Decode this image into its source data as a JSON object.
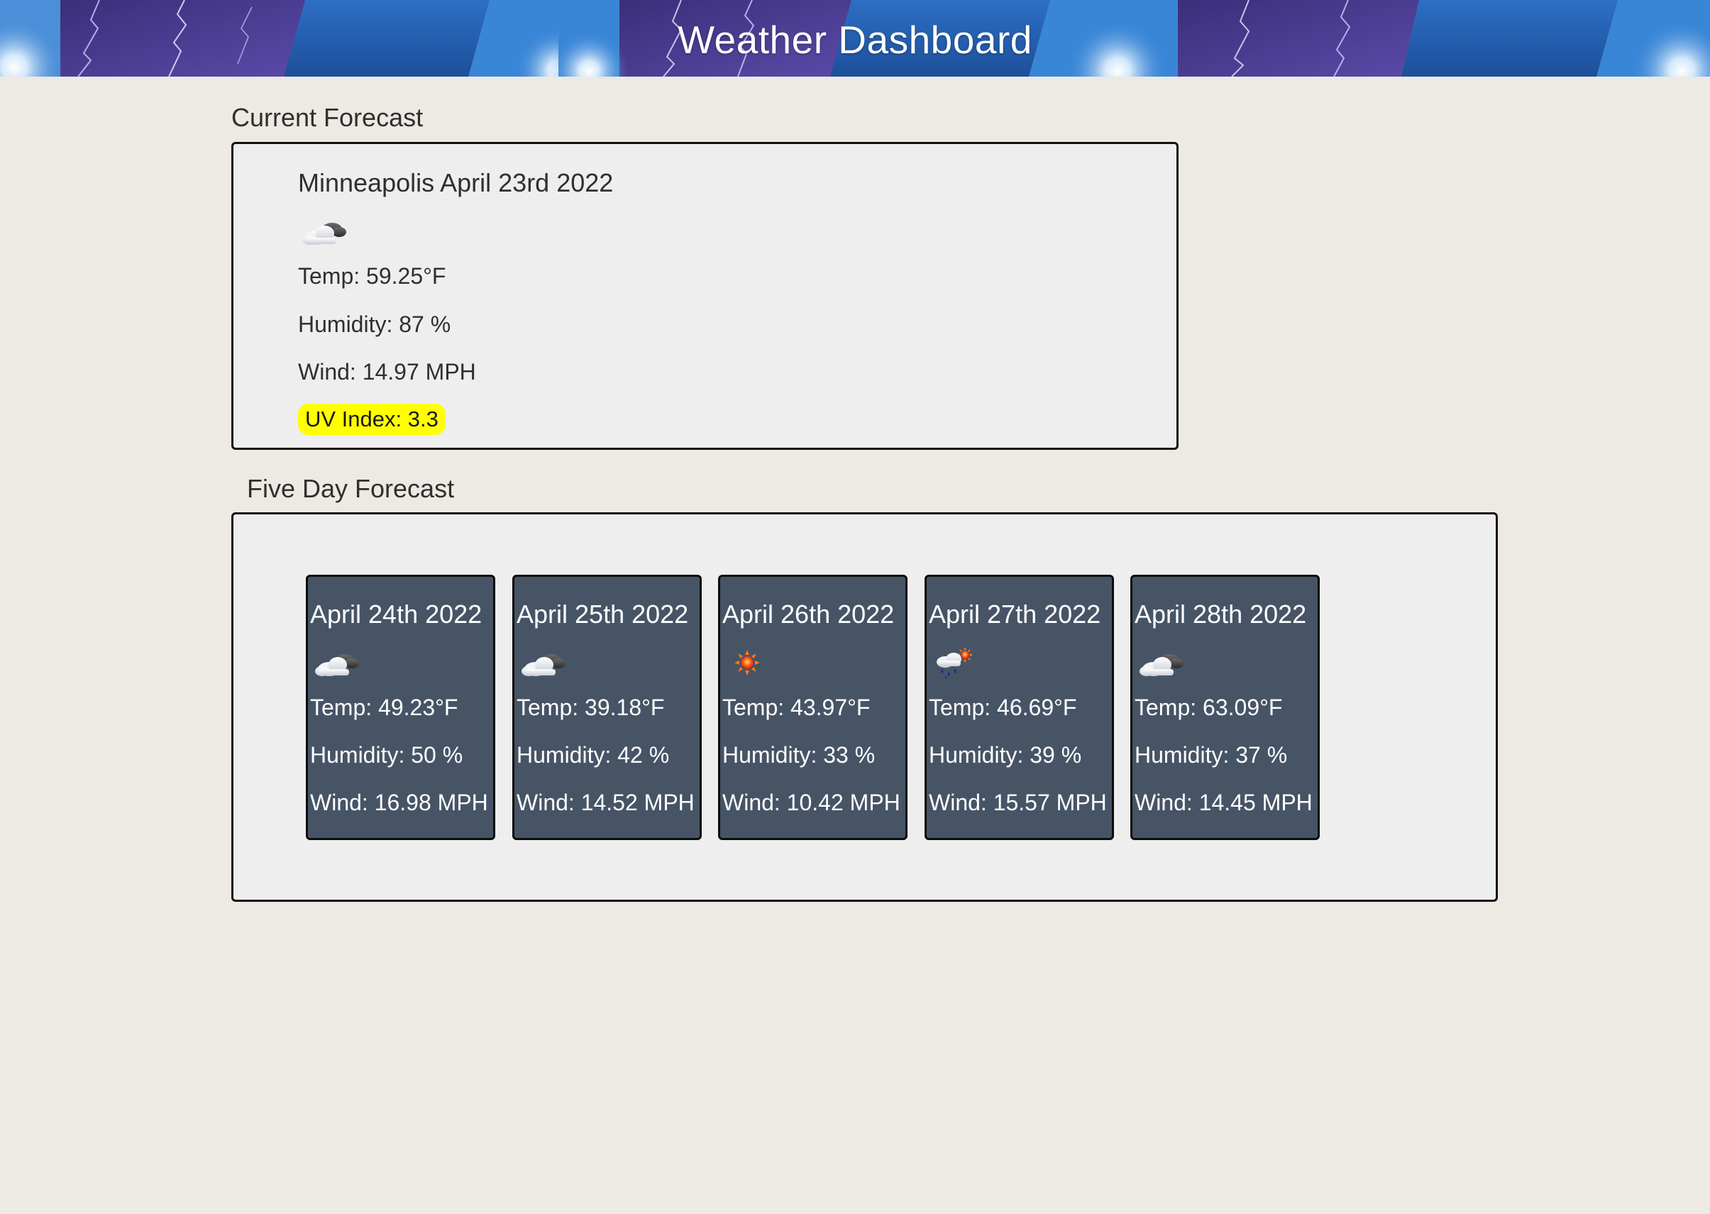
{
  "header": {
    "title": "Weather Dashboard"
  },
  "current": {
    "heading": "Current Forecast",
    "city_date": "Minneapolis April 23rd 2022",
    "icon": "partly-cloudy-icon",
    "temp": "Temp: 59.25°F",
    "humidity": "Humidity: 87 %",
    "wind": "Wind: 14.97 MPH",
    "uv": "UV Index: 3.3",
    "uv_color": "#ffff00"
  },
  "five_day": {
    "heading": "Five Day Forecast",
    "card_color": "#465466",
    "days": [
      {
        "date": "April 24th 2022",
        "icon": "partly-cloudy-icon",
        "temp": "Temp: 49.23°F",
        "humidity": "Humidity: 50 %",
        "wind": "Wind: 16.98 MPH"
      },
      {
        "date": "April 25th 2022",
        "icon": "partly-cloudy-icon",
        "temp": "Temp: 39.18°F",
        "humidity": "Humidity: 42 %",
        "wind": "Wind: 14.52 MPH"
      },
      {
        "date": "April 26th 2022",
        "icon": "sun-icon",
        "temp": "Temp: 43.97°F",
        "humidity": "Humidity: 33 %",
        "wind": "Wind: 10.42 MPH"
      },
      {
        "date": "April 27th 2022",
        "icon": "rain-sun-icon",
        "temp": "Temp: 46.69°F",
        "humidity": "Humidity: 39 %",
        "wind": "Wind: 15.57 MPH"
      },
      {
        "date": "April 28th 2022",
        "icon": "partly-cloudy-icon",
        "temp": "Temp: 63.09°F",
        "humidity": "Humidity: 37 %",
        "wind": "Wind: 14.45 MPH"
      }
    ]
  }
}
